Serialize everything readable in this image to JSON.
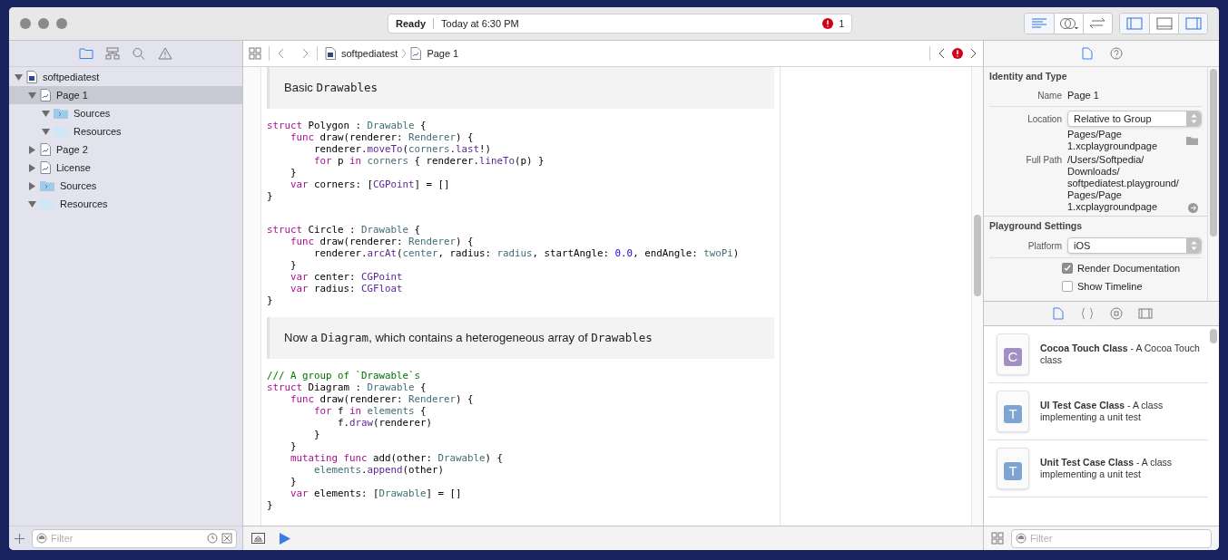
{
  "status": {
    "state": "Ready",
    "time": "Today at 6:30 PM",
    "errors": "1"
  },
  "toolbar": {
    "editor_modes": [
      {
        "kind": "standard",
        "selected": true
      },
      {
        "kind": "assistant",
        "selected": false
      },
      {
        "kind": "version",
        "selected": false
      }
    ],
    "panels": [
      {
        "kind": "navigator",
        "on": true
      },
      {
        "kind": "debug",
        "on": false
      },
      {
        "kind": "utilities",
        "on": true
      }
    ]
  },
  "navigator": {
    "tabs": [
      {
        "kind": "folder",
        "selected": true
      },
      {
        "kind": "hierarchy",
        "selected": false
      },
      {
        "kind": "search",
        "selected": false
      },
      {
        "kind": "warning",
        "selected": false
      }
    ],
    "tree": [
      {
        "label": "softpediatest",
        "kind": "playground",
        "expanded": true,
        "selected": false,
        "children": [
          {
            "label": "Page 1",
            "kind": "page",
            "expanded": true,
            "selected": true,
            "children": [
              {
                "label": "Sources",
                "kind": "source-folder",
                "expanded": true,
                "selected": false
              },
              {
                "label": "Resources",
                "kind": "folder",
                "expanded": true,
                "selected": false
              }
            ]
          },
          {
            "label": "Page 2",
            "kind": "page",
            "expanded": false,
            "selected": false
          },
          {
            "label": "License",
            "kind": "page",
            "expanded": false,
            "selected": false
          },
          {
            "label": "Sources",
            "kind": "source-folder",
            "expanded": false,
            "selected": false
          },
          {
            "label": "Resources",
            "kind": "folder",
            "expanded": true,
            "selected": false
          }
        ]
      }
    ],
    "filter": {
      "placeholder": "Filter"
    }
  },
  "jump_bar": {
    "path": [
      {
        "label": "softpediatest",
        "kind": "playground"
      },
      {
        "label": "Page 1",
        "kind": "page"
      }
    ]
  },
  "editor": {
    "sections": [
      {
        "kind": "markdown",
        "segments": [
          {
            "kind": "text",
            "text": "Basic "
          },
          {
            "kind": "code",
            "text": "Drawables"
          }
        ]
      },
      {
        "kind": "code",
        "lines": [
          [
            {
              "kind": "kw",
              "text": "struct"
            },
            {
              "kind": "p",
              "text": " Polygon : "
            },
            {
              "kind": "t",
              "text": "Drawable"
            },
            {
              "kind": "p",
              "text": " {"
            }
          ],
          [
            {
              "kind": "kw",
              "text": "    func"
            },
            {
              "kind": "p",
              "text": " draw(renderer: "
            },
            {
              "kind": "t",
              "text": "Renderer"
            },
            {
              "kind": "p",
              "text": ") {"
            }
          ],
          [
            {
              "kind": "p",
              "text": "        renderer."
            },
            {
              "kind": "c",
              "text": "moveTo"
            },
            {
              "kind": "p",
              "text": "("
            },
            {
              "kind": "t",
              "text": "corners"
            },
            {
              "kind": "p",
              "text": "."
            },
            {
              "kind": "c",
              "text": "last"
            },
            {
              "kind": "p",
              "text": "!)"
            }
          ],
          [
            {
              "kind": "kw",
              "text": "        for"
            },
            {
              "kind": "p",
              "text": " p "
            },
            {
              "kind": "kw",
              "text": "in"
            },
            {
              "kind": "t",
              "text": " corners"
            },
            {
              "kind": "p",
              "text": " { renderer."
            },
            {
              "kind": "c",
              "text": "lineTo"
            },
            {
              "kind": "p",
              "text": "(p) }"
            }
          ],
          [
            {
              "kind": "p",
              "text": "    }"
            }
          ],
          [
            {
              "kind": "kw",
              "text": "    var"
            },
            {
              "kind": "p",
              "text": " corners: ["
            },
            {
              "kind": "c",
              "text": "CGPoint"
            },
            {
              "kind": "p",
              "text": "] = []"
            }
          ],
          [
            {
              "kind": "p",
              "text": "}"
            }
          ]
        ]
      },
      {
        "kind": "code",
        "lines": [
          [
            {
              "kind": "kw",
              "text": "struct"
            },
            {
              "kind": "p",
              "text": " Circle : "
            },
            {
              "kind": "t",
              "text": "Drawable"
            },
            {
              "kind": "p",
              "text": " {"
            }
          ],
          [
            {
              "kind": "kw",
              "text": "    func"
            },
            {
              "kind": "p",
              "text": " draw(renderer: "
            },
            {
              "kind": "t",
              "text": "Renderer"
            },
            {
              "kind": "p",
              "text": ") {"
            }
          ],
          [
            {
              "kind": "p",
              "text": "        renderer."
            },
            {
              "kind": "c",
              "text": "arcAt"
            },
            {
              "kind": "p",
              "text": "("
            },
            {
              "kind": "t",
              "text": "center"
            },
            {
              "kind": "p",
              "text": ", radius: "
            },
            {
              "kind": "t",
              "text": "radius"
            },
            {
              "kind": "p",
              "text": ", startAngle: "
            },
            {
              "kind": "n",
              "text": "0.0"
            },
            {
              "kind": "p",
              "text": ", endAngle: "
            },
            {
              "kind": "t",
              "text": "twoPi"
            },
            {
              "kind": "p",
              "text": ")"
            }
          ],
          [
            {
              "kind": "p",
              "text": "    }"
            }
          ],
          [
            {
              "kind": "kw",
              "text": "    var"
            },
            {
              "kind": "p",
              "text": " center: "
            },
            {
              "kind": "c",
              "text": "CGPoint"
            }
          ],
          [
            {
              "kind": "kw",
              "text": "    var"
            },
            {
              "kind": "p",
              "text": " radius: "
            },
            {
              "kind": "c",
              "text": "CGFloat"
            }
          ],
          [
            {
              "kind": "p",
              "text": "}"
            }
          ]
        ]
      },
      {
        "kind": "markdown",
        "segments": [
          {
            "kind": "text",
            "text": "Now a "
          },
          {
            "kind": "code",
            "text": "Diagram"
          },
          {
            "kind": "text",
            "text": ", which contains a heterogeneous array of "
          },
          {
            "kind": "code",
            "text": "Drawables"
          }
        ]
      },
      {
        "kind": "code",
        "lines": [
          [
            {
              "kind": "cm",
              "text": "/// A group of `Drawable`s"
            }
          ],
          [
            {
              "kind": "kw",
              "text": "struct"
            },
            {
              "kind": "p",
              "text": " Diagram : "
            },
            {
              "kind": "t",
              "text": "Drawable"
            },
            {
              "kind": "p",
              "text": " {"
            }
          ],
          [
            {
              "kind": "kw",
              "text": "    func"
            },
            {
              "kind": "p",
              "text": " draw(renderer: "
            },
            {
              "kind": "t",
              "text": "Renderer"
            },
            {
              "kind": "p",
              "text": ") {"
            }
          ],
          [
            {
              "kind": "kw",
              "text": "        for"
            },
            {
              "kind": "p",
              "text": " f "
            },
            {
              "kind": "kw",
              "text": "in"
            },
            {
              "kind": "t",
              "text": " elements"
            },
            {
              "kind": "p",
              "text": " {"
            }
          ],
          [
            {
              "kind": "p",
              "text": "            f."
            },
            {
              "kind": "c",
              "text": "draw"
            },
            {
              "kind": "p",
              "text": "(renderer)"
            }
          ],
          [
            {
              "kind": "p",
              "text": "        }"
            }
          ],
          [
            {
              "kind": "p",
              "text": "    }"
            }
          ],
          [
            {
              "kind": "kw",
              "text": "    mutating func"
            },
            {
              "kind": "p",
              "text": " add(other: "
            },
            {
              "kind": "t",
              "text": "Drawable"
            },
            {
              "kind": "p",
              "text": ") {"
            }
          ],
          [
            {
              "kind": "t",
              "text": "        elements"
            },
            {
              "kind": "p",
              "text": "."
            },
            {
              "kind": "c",
              "text": "append"
            },
            {
              "kind": "p",
              "text": "(other)"
            }
          ],
          [
            {
              "kind": "p",
              "text": "    }"
            }
          ],
          [
            {
              "kind": "kw",
              "text": "    var"
            },
            {
              "kind": "p",
              "text": " elements: ["
            },
            {
              "kind": "t",
              "text": "Drawable"
            },
            {
              "kind": "p",
              "text": "] = []"
            }
          ],
          [
            {
              "kind": "p",
              "text": "}"
            }
          ]
        ]
      }
    ]
  },
  "inspector": {
    "tabs": [
      {
        "kind": "file",
        "selected": true
      },
      {
        "kind": "help",
        "selected": false
      }
    ],
    "identity": {
      "title": "Identity and Type",
      "name_label": "Name",
      "name": "Page 1",
      "location_label": "Location",
      "location": "Relative to Group",
      "path_lines": [
        "Pages/Page",
        "1.xcplaygroundpage"
      ],
      "full_path_label": "Full Path",
      "full_path_lines": [
        "/Users/Softpedia/",
        "Downloads/",
        "softpediatest.playground/",
        "Pages/Page",
        "1.xcplaygroundpage"
      ]
    },
    "playground": {
      "title": "Playground Settings",
      "platform_label": "Platform",
      "platform": "iOS",
      "options": [
        {
          "label": "Render Documentation",
          "checked": true
        },
        {
          "label": "Show Timeline",
          "checked": false
        }
      ]
    }
  },
  "library": {
    "tabs": [
      {
        "kind": "file",
        "selected": true
      },
      {
        "kind": "braces",
        "selected": false
      },
      {
        "kind": "object",
        "selected": false
      },
      {
        "kind": "media",
        "selected": false
      }
    ],
    "items": [
      {
        "text": "**Cocoa Touch Class** - A Cocoa Touch class",
        "badge": "C",
        "color": "#a28fc4"
      },
      {
        "text": "**UI Test Case Class** - A class implementing a unit test",
        "badge": "T",
        "color": "#7ea4d4"
      },
      {
        "text": "**Unit Test Case Class** - A class implementing a unit test",
        "badge": "T",
        "color": "#7ea4d4"
      }
    ],
    "filter": {
      "placeholder": "Filter"
    }
  }
}
